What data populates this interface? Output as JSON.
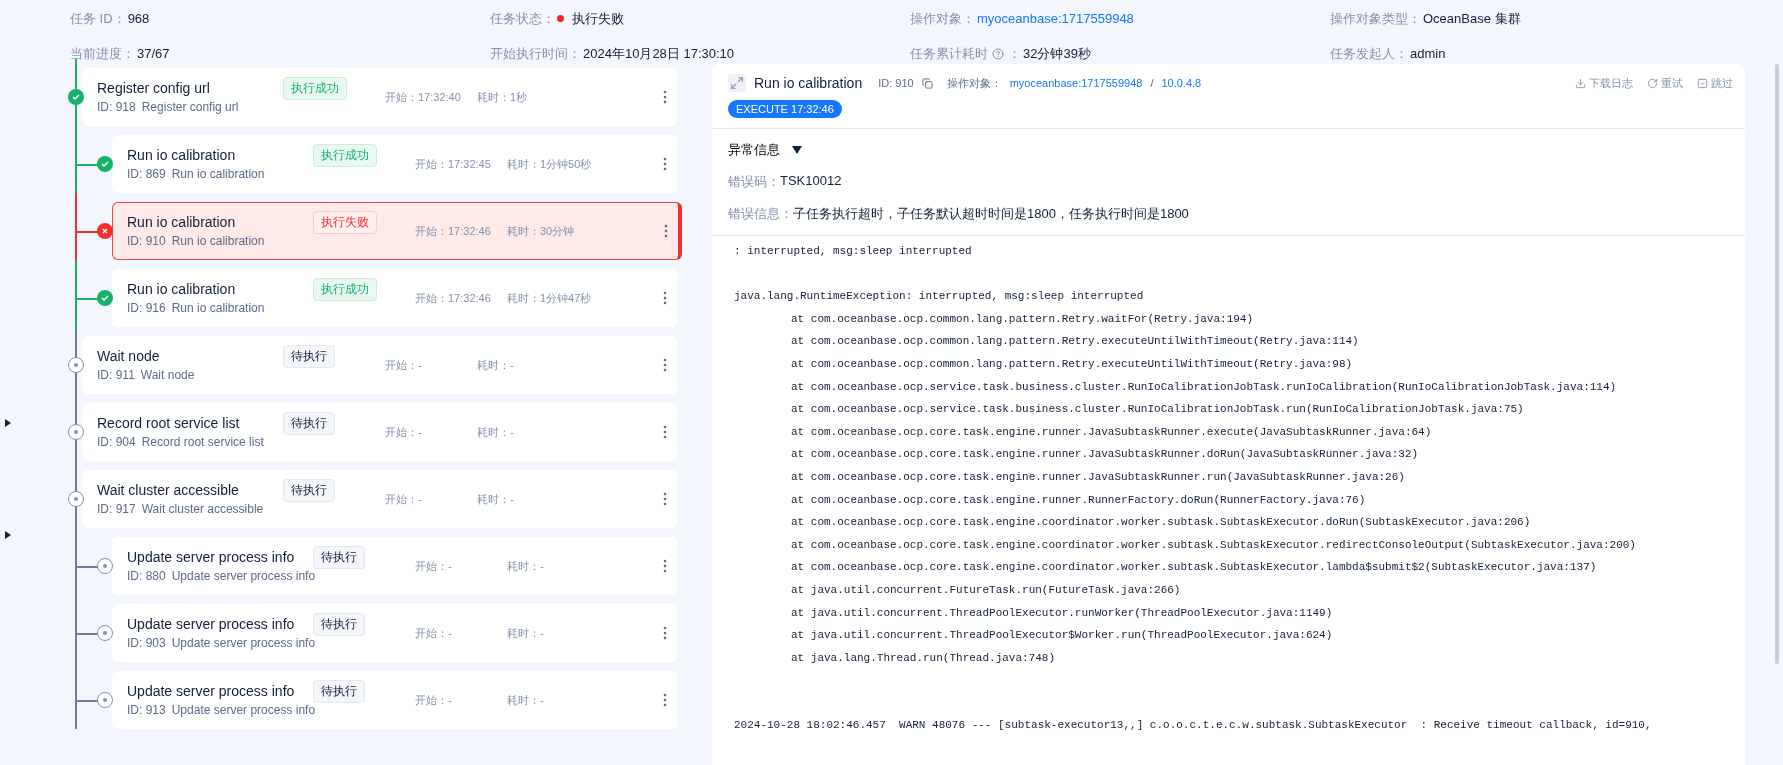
{
  "header": {
    "fields": [
      {
        "label": "任务 ID：",
        "value": "968",
        "kind": "text"
      },
      {
        "label": "任务状态：",
        "value": "执行失败",
        "kind": "status",
        "color": "#f5222d"
      },
      {
        "label": "操作对象：",
        "value": "myoceanbase:1717559948",
        "kind": "link"
      },
      {
        "label": "操作对象类型：",
        "value": "OceanBase 集群",
        "kind": "text"
      },
      {
        "label": "当前进度：",
        "value": "37/67",
        "kind": "text"
      },
      {
        "label": "开始执行时间：",
        "value": "2024年10月28日 17:30:10",
        "kind": "text"
      },
      {
        "label": "任务累计耗时",
        "suffix": "：",
        "value": "32分钟39秒",
        "kind": "help"
      },
      {
        "label": "任务发起人：",
        "value": "admin",
        "kind": "text"
      }
    ]
  },
  "tasks": [
    {
      "title": "Register config url",
      "id": "ID: 918",
      "name": "Register config url",
      "kind": "success",
      "badge": "执行成功",
      "start": "开始：17:32:40",
      "duration": "耗时：1秒",
      "selected": false,
      "children": [
        {
          "title": "Run io calibration",
          "id": "ID: 869",
          "name": "Run io calibration",
          "kind": "success",
          "badge": "执行成功",
          "start": "开始：17:32:45",
          "duration": "耗时：1分钟50秒",
          "selected": false
        },
        {
          "title": "Run io calibration",
          "id": "ID: 910",
          "name": "Run io calibration",
          "kind": "failed",
          "badge": "执行失败",
          "start": "开始：17:32:46",
          "duration": "耗时：30分钟",
          "selected": true
        },
        {
          "title": "Run io calibration",
          "id": "ID: 916",
          "name": "Run io calibration",
          "kind": "success",
          "badge": "执行成功",
          "start": "开始：17:32:46",
          "duration": "耗时：1分钟47秒",
          "selected": false
        }
      ]
    },
    {
      "title": "Wait node",
      "id": "ID: 911",
      "name": "Wait node",
      "kind": "pending",
      "badge": "待执行",
      "start": "开始：-",
      "duration": "耗时：-",
      "selected": false
    },
    {
      "title": "Record root service list",
      "id": "ID: 904",
      "name": "Record root service list",
      "kind": "pending",
      "badge": "待执行",
      "start": "开始：-",
      "duration": "耗时：-",
      "selected": false
    },
    {
      "title": "Wait cluster accessible",
      "id": "ID: 917",
      "name": "Wait cluster accessible",
      "kind": "pending",
      "badge": "待执行",
      "start": "开始：-",
      "duration": "耗时：-",
      "selected": false,
      "children": [
        {
          "title": "Update server process info",
          "id": "ID: 880",
          "name": "Update server process info",
          "kind": "pending",
          "badge": "待执行",
          "start": "开始：-",
          "duration": "耗时：-",
          "selected": false
        },
        {
          "title": "Update server process info",
          "id": "ID: 903",
          "name": "Update server process info",
          "kind": "pending",
          "badge": "待执行",
          "start": "开始：-",
          "duration": "耗时：-",
          "selected": false
        },
        {
          "title": "Update server process info",
          "id": "ID: 913",
          "name": "Update server process info",
          "kind": "pending",
          "badge": "待执行",
          "start": "开始：-",
          "duration": "耗时：-",
          "selected": false
        }
      ]
    }
  ],
  "detail": {
    "title": "Run io calibration",
    "id": "ID: 910",
    "target_label": "操作对象：",
    "target": "myoceanbase:1717559948",
    "separator": "/",
    "address": "10.0.4.8",
    "actions": [
      {
        "label": "下载日志",
        "kind": "download"
      },
      {
        "label": "重试",
        "kind": "retry"
      },
      {
        "label": "跳过",
        "kind": "skip"
      }
    ],
    "execute_tag": "EXECUTE 17:32:46",
    "error": {
      "title": "异常信息",
      "expanded": true,
      "code_label": "错误码：",
      "code": "TSK10012",
      "message_label": "错误信息：",
      "message": "子任务执行超时，子任务默认超时时间是1800，任务执行时间是1800"
    },
    "log": [
      {
        "kind": "text",
        "text": ": interrupted, msg:sleep interrupted"
      },
      {
        "kind": "gap"
      },
      {
        "kind": "text",
        "text": "java.lang.RuntimeException: interrupted, msg:sleep interrupted"
      },
      {
        "kind": "frame",
        "text": "at com.oceanbase.ocp.common.lang.pattern.Retry.waitFor(Retry.java:194)"
      },
      {
        "kind": "frame",
        "text": "at com.oceanbase.ocp.common.lang.pattern.Retry.executeUntilWithTimeout(Retry.java:114)"
      },
      {
        "kind": "frame",
        "text": "at com.oceanbase.ocp.common.lang.pattern.Retry.executeUntilWithTimeout(Retry.java:98)"
      },
      {
        "kind": "frame",
        "text": "at com.oceanbase.ocp.service.task.business.cluster.RunIoCalibrationJobTask.runIoCalibration(RunIoCalibrationJobTask.java:114)"
      },
      {
        "kind": "frame",
        "text": "at com.oceanbase.ocp.service.task.business.cluster.RunIoCalibrationJobTask.run(RunIoCalibrationJobTask.java:75)"
      },
      {
        "kind": "frame",
        "text": "at com.oceanbase.ocp.core.task.engine.runner.JavaSubtaskRunner.execute(JavaSubtaskRunner.java:64)"
      },
      {
        "kind": "frame",
        "text": "at com.oceanbase.ocp.core.task.engine.runner.JavaSubtaskRunner.doRun(JavaSubtaskRunner.java:32)"
      },
      {
        "kind": "frame",
        "text": "at com.oceanbase.ocp.core.task.engine.runner.JavaSubtaskRunner.run(JavaSubtaskRunner.java:26)"
      },
      {
        "kind": "frame",
        "text": "at com.oceanbase.ocp.core.task.engine.runner.RunnerFactory.doRun(RunnerFactory.java:76)"
      },
      {
        "kind": "frame",
        "text": "at com.oceanbase.ocp.core.task.engine.coordinator.worker.subtask.SubtaskExecutor.doRun(SubtaskExecutor.java:206)"
      },
      {
        "kind": "frame",
        "text": "at com.oceanbase.ocp.core.task.engine.coordinator.worker.subtask.SubtaskExecutor.redirectConsoleOutput(SubtaskExecutor.java:200)"
      },
      {
        "kind": "frame",
        "text": "at com.oceanbase.ocp.core.task.engine.coordinator.worker.subtask.SubtaskExecutor.lambda$submit$2(SubtaskExecutor.java:137)"
      },
      {
        "kind": "frame",
        "text": "at java.util.concurrent.FutureTask.run(FutureTask.java:266)"
      },
      {
        "kind": "frame",
        "text": "at java.util.concurrent.ThreadPoolExecutor.runWorker(ThreadPoolExecutor.java:1149)"
      },
      {
        "kind": "frame",
        "text": "at java.util.concurrent.ThreadPoolExecutor$Worker.run(ThreadPoolExecutor.java:624)"
      },
      {
        "kind": "frame",
        "text": "at java.lang.Thread.run(Thread.java:748)"
      },
      {
        "kind": "gap"
      },
      {
        "kind": "gap"
      },
      {
        "kind": "text",
        "text": "2024-10-28 18:02:46.457  WARN 48076 --- [subtask-executor13,,] c.o.o.c.t.e.c.w.subtask.SubtaskExecutor  : Receive timeout callback, id=910,"
      }
    ]
  }
}
